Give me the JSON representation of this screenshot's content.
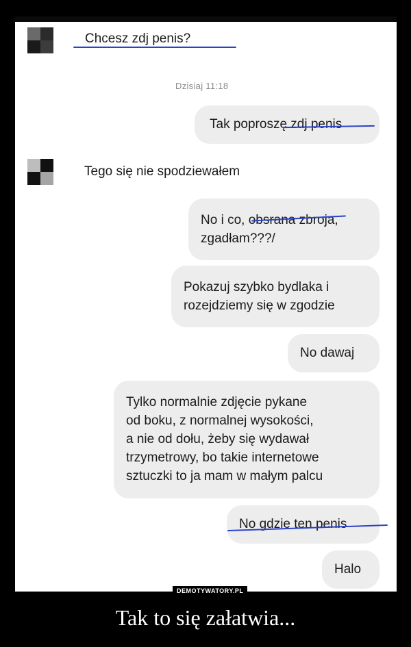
{
  "chat": {
    "incoming_1": "Chcesz zdj penis?",
    "timestamp": "Dzisiaj 11:18",
    "outgoing_1": "Tak poproszę zdj penis",
    "incoming_2": "Tego się nie spodziewałem",
    "outgoing_2": "No i co, obsrana zbroja,\nzgadłam???/",
    "outgoing_3": "Pokazuj szybko bydlaka i\nrozejdziemy się w zgodzie",
    "outgoing_4": "No dawaj",
    "outgoing_5": "Tylko normalnie zdjęcie pykane\nod boku, z normalnej wysokości,\na nie od dołu, żeby się wydawał\ntrzymetrowy, bo takie internetowe\nsztuczki to ja mam w małym palcu",
    "outgoing_6": "No gdzie ten penis",
    "outgoing_7": "Halo"
  },
  "footer": {
    "watermark": "DEMOTYWATORY.PL",
    "caption": "Tak to się załatwia..."
  },
  "colors": {
    "background": "#000000",
    "bubble": "#ededed",
    "scribble": "#2a43c8"
  }
}
